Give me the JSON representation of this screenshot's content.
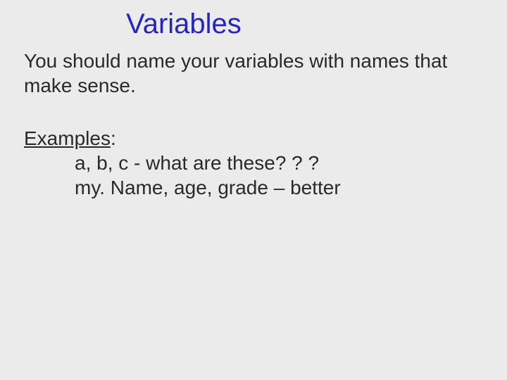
{
  "slide": {
    "title": "Variables",
    "intro": "You should name your variables with names that make sense.",
    "examples_label": "Examples",
    "colon": ":",
    "example1": "a, b, c  - what are these? ? ?",
    "example2": "my. Name, age, grade – better"
  }
}
